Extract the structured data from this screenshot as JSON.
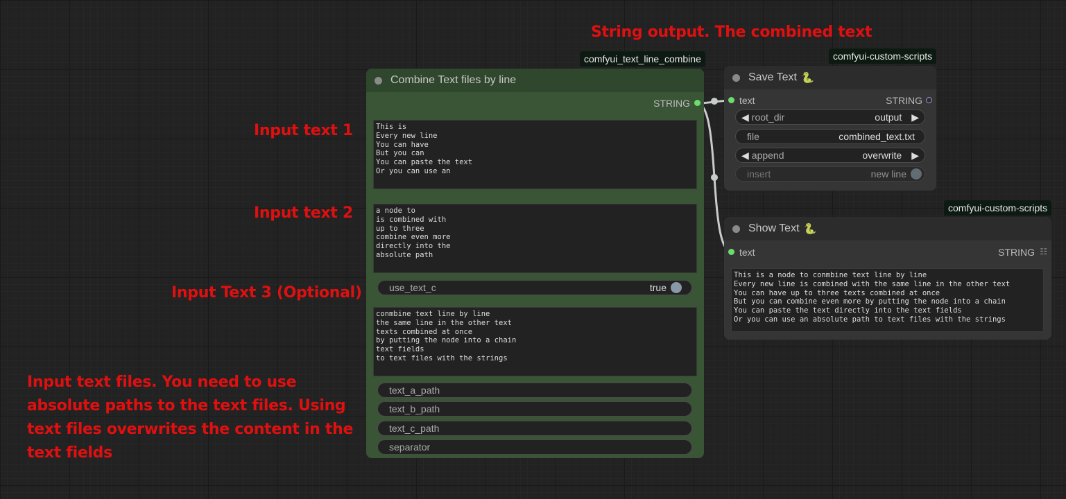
{
  "annotations": {
    "output": "String output. The combined text",
    "input1": "Input text 1",
    "input2": "Input text 2",
    "input3": "Input Text 3 (Optional)",
    "files_line1": "Input text files. You need to use",
    "files_line2": "absolute paths to the text files. Using",
    "files_line3": "text files overwrites the content in the",
    "files_line4": "text fields"
  },
  "combine_node": {
    "tag": "comfyui_text_line_combine",
    "title": "Combine Text files by line",
    "output_label": "STRING",
    "text_a": "This is\nEvery new line\nYou can have\nBut you can\nYou can paste the text\nOr you can use an",
    "text_b": "a node to\nis combined with\nup to three\ncombine even more\ndirectly into the\nabsolute path",
    "use_text_c_label": "use_text_c",
    "use_text_c_value": "true",
    "text_c": "conmbine text line by line\nthe same line in the other text\ntexts combined at once\nby putting the node into a chain\ntext fields\nto text files with the strings",
    "text_a_path": "text_a_path",
    "text_b_path": "text_b_path",
    "text_c_path": "text_c_path",
    "separator": "separator"
  },
  "save_node": {
    "tag": "comfyui-custom-scripts",
    "title": "Save Text",
    "input_label": "text",
    "output_label": "STRING",
    "root_dir_label": "root_dir",
    "root_dir_value": "output",
    "file_label": "file",
    "file_value": "combined_text.txt",
    "append_label": "append",
    "append_value": "overwrite",
    "insert_label": "insert",
    "insert_value": "new line"
  },
  "show_node": {
    "tag": "comfyui-custom-scripts",
    "title": "Show Text",
    "input_label": "text",
    "output_label": "STRING",
    "text": "This is a node to conmbine text line by line\nEvery new line is combined with the same line in the other text\nYou can have up to three texts combined at once\nBut you can combine even more by putting the node into a chain\nYou can paste the text directly into the text fields\nOr you can use an absolute path to text files with the strings"
  },
  "icons": {
    "title_emoji": "snake-icon",
    "list_icon": "grid-icon"
  },
  "colors": {
    "annotation": "#e01010",
    "combine_bg": "#3a5535",
    "combine_title": "#2f472c",
    "gray_node_bg": "#353535",
    "link": "#c8ccc8",
    "slot_green": "#6cdd6c"
  }
}
